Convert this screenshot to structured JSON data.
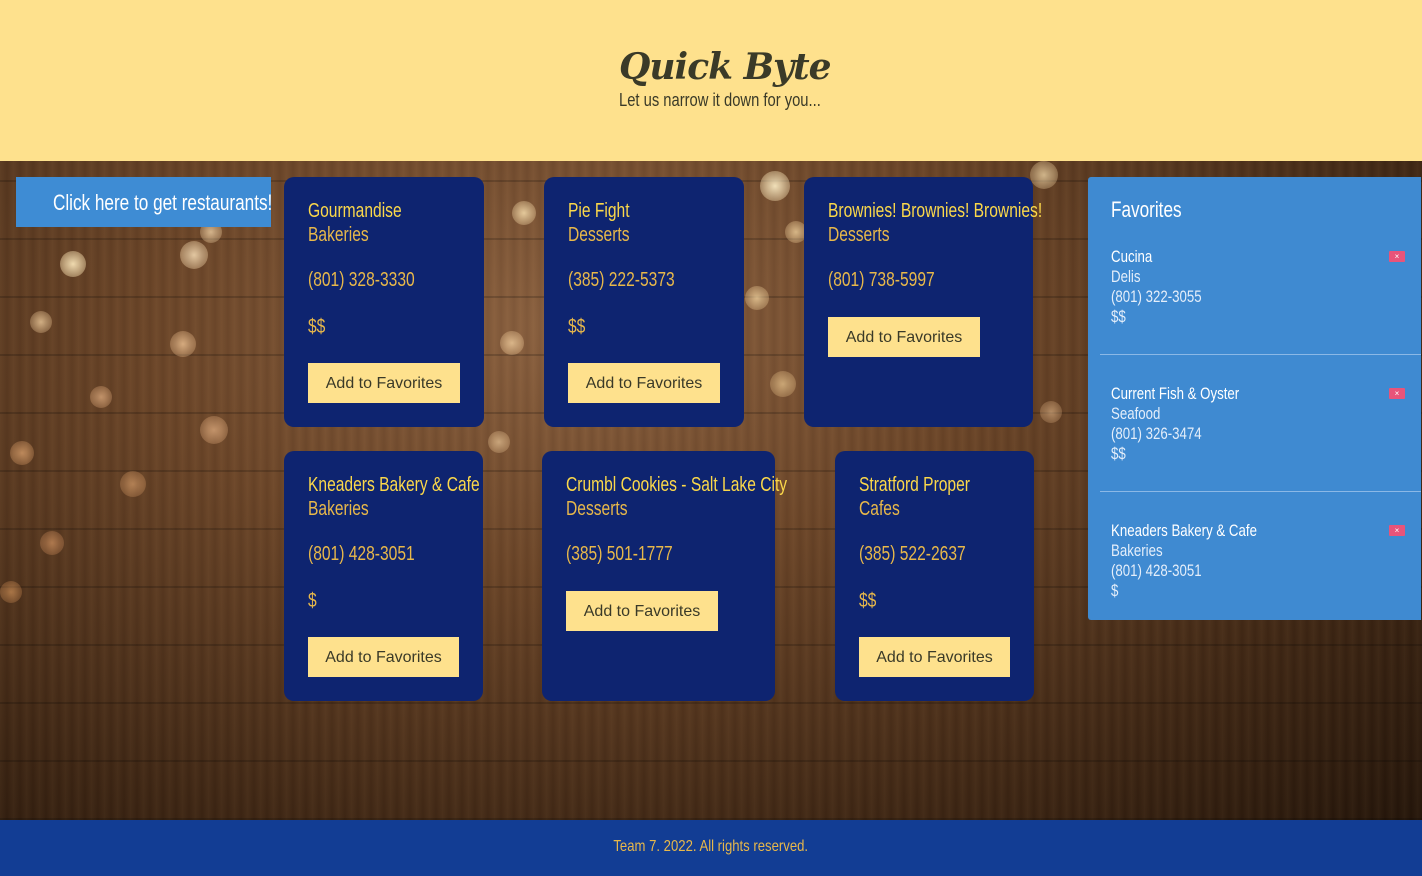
{
  "header": {
    "logo": "Quick Byte",
    "tagline": "Let us narrow it down for you..."
  },
  "get_button": "Click here to get restaurants!",
  "add_label": "Add to Favorites",
  "cards": [
    {
      "name": "Gourmandise",
      "category": "Bakeries",
      "phone": "(801) 328-3330",
      "price": "$$"
    },
    {
      "name": "Pie Fight",
      "category": "Desserts",
      "phone": "(385) 222-5373",
      "price": "$$"
    },
    {
      "name": "Brownies! Brownies! Brownies!",
      "category": "Desserts",
      "phone": "(801) 738-5997",
      "price": ""
    },
    {
      "name": "Kneaders Bakery & Cafe",
      "category": "Bakeries",
      "phone": "(801) 428-3051",
      "price": "$"
    },
    {
      "name": "Crumbl Cookies - Salt Lake City",
      "category": "Desserts",
      "phone": "(385) 501-1777",
      "price": ""
    },
    {
      "name": "Stratford Proper",
      "category": "Cafes",
      "phone": "(385) 522-2637",
      "price": "$$"
    }
  ],
  "favorites": {
    "title": "Favorites",
    "remove_label": "×",
    "items": [
      {
        "name": "Cucina",
        "category": "Delis",
        "phone": "(801) 322-3055",
        "price": "$$"
      },
      {
        "name": "Current Fish & Oyster",
        "category": "Seafood",
        "phone": "(801) 326-3474",
        "price": "$$"
      },
      {
        "name": "Kneaders Bakery & Cafe",
        "category": "Bakeries",
        "phone": "(801) 428-3051",
        "price": "$"
      }
    ]
  },
  "footer": {
    "text": "Team 7. 2022. All rights reserved."
  },
  "colors": {
    "header_bg": "#fee18d",
    "card_bg": "#0e2470",
    "card_title": "#fbd84a",
    "card_text": "#e8b84a",
    "favorites_bg": "#3f8ad1",
    "footer_bg": "#123d94",
    "remove_button": "#e8547a"
  }
}
